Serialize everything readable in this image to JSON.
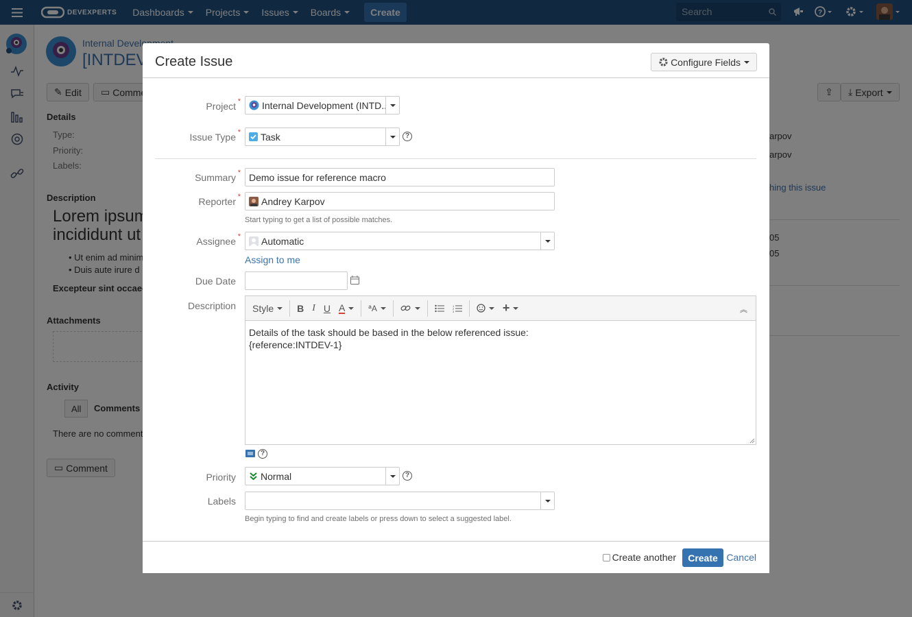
{
  "topnav": {
    "logo_text": "DEVEXPERTS",
    "menus": [
      "Dashboards",
      "Projects",
      "Issues",
      "Boards"
    ],
    "create": "Create",
    "search_placeholder": "Search"
  },
  "background": {
    "breadcrumb": "Internal Development",
    "issue_key": "[INTDEV-",
    "edit_btn": "Edit",
    "comment_btn": "Comme",
    "export_btn": "Export",
    "details_heading": "Details",
    "type_label": "Type:",
    "priority_label": "Priority:",
    "labels_label": "Labels:",
    "description_heading": "Description",
    "lorem_line1": "Lorem ipsum",
    "lorem_line2": "incididunt ut la",
    "bullet1": "Ut enim ad minim",
    "bullet2": "Duis aute irure d",
    "excepteur": "Excepteur sint occaec",
    "attachments_heading": "Attachments",
    "activity_heading": "Activity",
    "tab_all": "All",
    "tab_comments": "Comments",
    "no_comments": "There are no comments",
    "comment_bottom": "Comment",
    "right_person1": "arpov",
    "right_person2": "arpov",
    "right_link": "hing this issue",
    "right_date1": "05",
    "right_date2": "05"
  },
  "dialog": {
    "title": "Create Issue",
    "configure_fields": "Configure Fields",
    "project_label": "Project",
    "project_value": "Internal Development (INTD...",
    "issue_type_label": "Issue Type",
    "issue_type_value": "Task",
    "summary_label": "Summary",
    "summary_value": "Demo issue for reference macro",
    "reporter_label": "Reporter",
    "reporter_value": "Andrey Karpov",
    "reporter_hint": "Start typing to get a list of possible matches.",
    "assignee_label": "Assignee",
    "assignee_value": "Automatic",
    "assign_to_me": "Assign to me",
    "due_date_label": "Due Date",
    "due_date_value": "",
    "description_label": "Description",
    "toolbar_style": "Style",
    "description_line1": "Details of the task should be based in the below referenced issue:",
    "description_line2": "{reference:INTDEV-1}",
    "priority_label": "Priority",
    "priority_value": "Normal",
    "labels_label": "Labels",
    "labels_value": "",
    "labels_hint": "Begin typing to find and create labels or press down to select a suggested label.",
    "create_another": "Create another",
    "create_btn": "Create",
    "cancel": "Cancel"
  },
  "colors": {
    "topnav": "#205081",
    "primary": "#3572b0",
    "link": "#3b73af",
    "required": "#d04437",
    "priority_green": "#14892c"
  }
}
